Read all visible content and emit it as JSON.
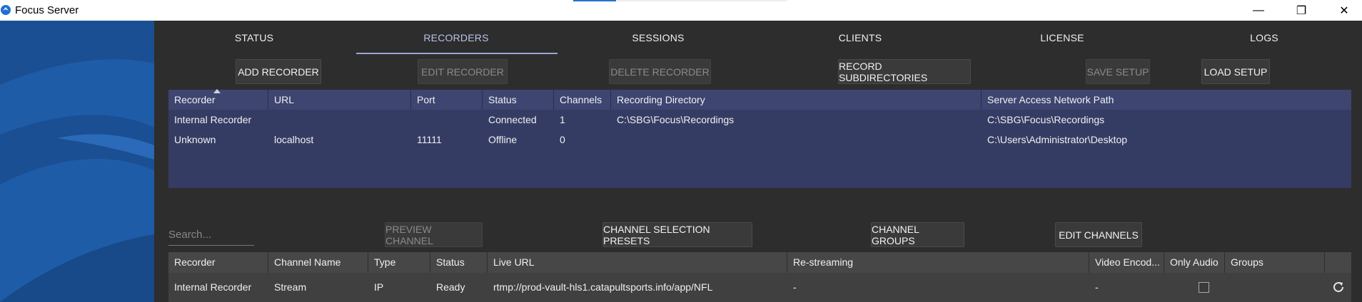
{
  "window": {
    "title": "Focus Server",
    "minimize_glyph": "—",
    "restore_glyph": "❐",
    "close_glyph": "✕"
  },
  "tabs": [
    {
      "label": "STATUS"
    },
    {
      "label": "RECORDERS",
      "active": true
    },
    {
      "label": "SESSIONS"
    },
    {
      "label": "CLIENTS"
    },
    {
      "label": "LICENSE"
    },
    {
      "label": "LOGS"
    }
  ],
  "recorder_toolbar": {
    "add": "ADD RECORDER",
    "edit": "EDIT RECORDER",
    "delete": "DELETE RECORDER",
    "subdirs": "RECORD SUBDIRECTORIES",
    "save": "SAVE SETUP",
    "load": "LOAD SETUP"
  },
  "recorders_table": {
    "columns": [
      "Recorder",
      "URL",
      "Port",
      "Status",
      "Channels",
      "Recording Directory",
      "Server Access Network Path"
    ],
    "rows": [
      [
        "Internal Recorder",
        "",
        "",
        "Connected",
        "1",
        "C:\\SBG\\Focus\\Recordings",
        "C:\\SBG\\Focus\\Recordings"
      ],
      [
        "Unknown",
        "localhost",
        "11111",
        "Offline",
        "0",
        "",
        "C:\\Users\\Administrator\\Desktop"
      ]
    ]
  },
  "channel_toolbar": {
    "search_placeholder": "Search...",
    "preview": "PREVIEW CHANNEL",
    "presets": "CHANNEL SELECTION PRESETS",
    "groups": "CHANNEL GROUPS",
    "edit": "EDIT CHANNELS"
  },
  "channels_table": {
    "columns": [
      "Recorder",
      "Channel Name",
      "Type",
      "Status",
      "Live URL",
      "Re-streaming",
      "Video Encod...",
      "Only Audio",
      "Groups"
    ],
    "rows": [
      {
        "recorder": "Internal Recorder",
        "channel_name": "Stream",
        "type": "IP",
        "status": "Ready",
        "live_url": "rtmp://prod-vault-hls1.catapultsports.info/app/NFL",
        "restreaming": "-",
        "video_encoding": "-",
        "only_audio": false,
        "groups": ""
      }
    ]
  },
  "colors": {
    "accent_blue": "#1f5ca8",
    "table_blue": "#353c64",
    "tab_active": "#b9c3ea"
  }
}
